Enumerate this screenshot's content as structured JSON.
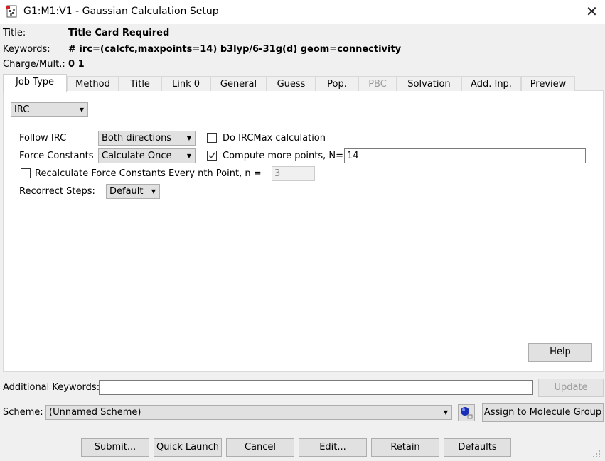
{
  "window": {
    "title": "G1:M1:V1 - Gaussian Calculation Setup",
    "close_glyph": "✕"
  },
  "header": {
    "title_label": "Title:",
    "title_value": "Title Card Required",
    "keywords_label": "Keywords:",
    "keywords_value": "# irc=(calcfc,maxpoints=14) b3lyp/6-31g(d) geom=connectivity",
    "charge_label": "Charge/Mult.:",
    "charge_value": "0 1"
  },
  "tabs": [
    {
      "label": "Job Type"
    },
    {
      "label": "Method"
    },
    {
      "label": "Title"
    },
    {
      "label": "Link 0"
    },
    {
      "label": "General"
    },
    {
      "label": "Guess"
    },
    {
      "label": "Pop."
    },
    {
      "label": "PBC"
    },
    {
      "label": "Solvation"
    },
    {
      "label": "Add. Inp."
    },
    {
      "label": "Preview"
    }
  ],
  "job_type": {
    "selected": "IRC",
    "follow_irc_label": "Follow IRC",
    "follow_irc_value": "Both directions",
    "force_constants_label": "Force Constants",
    "force_constants_value": "Calculate Once",
    "do_ircmax_label": "Do IRCMax calculation",
    "do_ircmax_checked": false,
    "compute_more_label": "Compute more points, N=",
    "compute_more_checked": true,
    "compute_more_value": "14",
    "recalc_label": "Recalculate Force Constants Every nth Point, n =",
    "recalc_checked": false,
    "recalc_value": "3",
    "recorrect_label": "Recorrect Steps:",
    "recorrect_value": "Default",
    "help_label": "Help"
  },
  "additional": {
    "label": "Additional Keywords:",
    "value": "",
    "update_label": "Update"
  },
  "scheme": {
    "label": "Scheme:",
    "value": "(Unnamed Scheme)",
    "assign_label": "Assign to Molecule Group"
  },
  "buttons": {
    "submit": "Submit...",
    "quick_launch": "Quick Launch",
    "cancel": "Cancel",
    "edit": "Edit...",
    "retain": "Retain",
    "defaults": "Defaults"
  },
  "colors": {
    "accent_check": "#333333",
    "panel_bg": "#ffffff",
    "window_bg": "#f0f0f0"
  }
}
